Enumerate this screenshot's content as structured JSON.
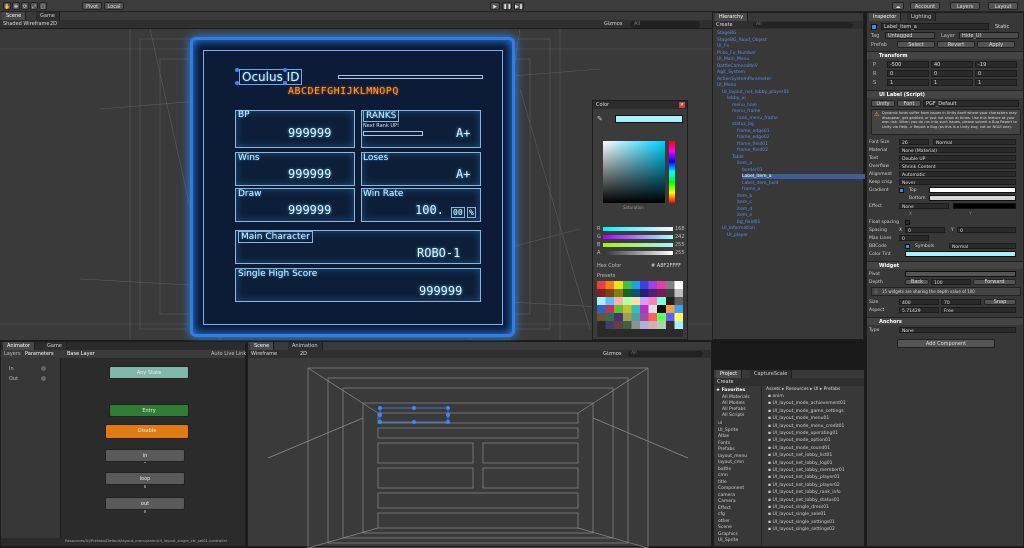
{
  "toolbar": {
    "pivot_label": "Pivot",
    "local_label": "Local",
    "account_label": "Account",
    "layers_label": "Layers",
    "layout_label": "Layout"
  },
  "scene": {
    "tab_scene": "Scene",
    "tab_game": "Game",
    "shading_mode": "Shaded Wireframe",
    "twod_label": "2D",
    "gizmos_label": "Gizmos",
    "search_placeholder": "All"
  },
  "game_ui": {
    "title": "Oculus ID",
    "id_text": "ABCDEFGHIJKLMNOPQ",
    "bp_label": "BP",
    "bp_value": "999999",
    "ranks_label": "RANKS",
    "next_rank_label": "Next Rank UP!",
    "rank_value": "A+",
    "wins_label": "Wins",
    "wins_value": "999999",
    "loses_label": "Loses",
    "loses_value": "A+",
    "draw_label": "Draw",
    "draw_value": "999999",
    "win_rate_label": "Win Rate",
    "win_rate_value": "100.",
    "win_rate_decimal": "00",
    "percent_label": "%",
    "main_char_label": "Main Character",
    "main_char_value": "ROBO-1",
    "high_score_label": "Single High Score",
    "high_score_value": "999999"
  },
  "color_picker": {
    "title": "Color",
    "saturation_label": "Saturation",
    "hex_label": "Hex Color",
    "hex_value": "# A8F2FFFF",
    "presets_label": "Presets",
    "channels": [
      {
        "label": "R",
        "value": "168"
      },
      {
        "label": "G",
        "value": "242"
      },
      {
        "label": "B",
        "value": "255"
      },
      {
        "label": "A",
        "value": "255"
      }
    ]
  },
  "hierarchy": {
    "tab": "Hierarchy",
    "create_label": "Create",
    "search_placeholder": "All",
    "items": [
      "StageBG",
      "StageBG_Road_Object",
      "UI_Fx",
      "Prize_Fx_Number",
      "UI_Main_Menu",
      "BattleCameraMoV",
      "Agit_System",
      "ActionSystemParameter",
      "UI_Menu",
      "UI_layout_net_lobby_player01",
      "lobby_ui",
      "menu_hole",
      "menu_frame",
      "rank_menu_frame",
      "status_bg",
      "frame_edge01",
      "frame_edge02",
      "frame_field01",
      "frame_field02",
      "Table",
      "item_a",
      "border01",
      "Label_item_a",
      "Label_item_hold",
      "frame_a",
      "item_b",
      "item_c",
      "item_d",
      "item_e",
      "bg_field01",
      "UI_Information",
      "UI_player"
    ]
  },
  "inspector": {
    "tab_inspector": "Inspector",
    "tab_lighting": "Lighting",
    "object_name": "Label_item_a",
    "static_label": "Static",
    "tag_label": "Tag",
    "tag_value": "Untagged",
    "layer_label": "Layer",
    "layer_value": "Hide_UI",
    "prefab_label": "Prefab",
    "prefab_select": "Select",
    "prefab_revert": "Revert",
    "prefab_apply": "Apply",
    "transform_label": "Transform",
    "position_label": "P",
    "position_values": [
      "-500",
      "40",
      "-19"
    ],
    "rotation_label": "R",
    "rotation_values": [
      "0",
      "0",
      "0"
    ],
    "scale_label": "S",
    "scale_values": [
      "1",
      "1",
      "1"
    ],
    "component_label": "UI Label (Script)",
    "component_tabs": [
      "Unity",
      "Font",
      "PGF_Default"
    ],
    "warning_text": "Dynamic fonts suffer from issues in Unity itself where your characters may disappear, get garbled, or just not show at times. Use this feature at your own risk.",
    "warning_text2": "When you do run into such issues, please submit a Bug Report to Unity via Help -> Report a Bug (as this is a Unity bug, not an NGUI one).",
    "font_size_label": "Font Size",
    "font_size_value": "26",
    "font_style_value": "Normal",
    "material_label": "Material",
    "material_value": "None (Material)",
    "text_label": "Text",
    "text_value": "Double UP",
    "overflow_label": "Overflow",
    "overflow_value": "Shrink Content",
    "alignment_label": "Alignment",
    "alignment_value": "Automatic",
    "keep_crisp_label": "Keep crisp",
    "keep_crisp_value": "Never",
    "gradient_label": "Gradient",
    "gradient_top": "Top",
    "gradient_bottom": "Bottom",
    "effect_label": "Effect",
    "effect_value": "None",
    "effect_x": "X",
    "effect_y": "Y",
    "float_spacing_label": "Float spacing",
    "spacing_label": "Spacing",
    "spacing_x": "0",
    "spacing_y": "0",
    "max_lines_label": "Max Lines",
    "max_lines_value": "0",
    "bbcode_label": "BBCode",
    "symbols_label": "Symbols",
    "symbols_value": "Normal",
    "color_tint_label": "Color Tint",
    "widget_label": "Widget",
    "pivot_label": "Pivot",
    "depth_label": "Depth",
    "back_label": "Back",
    "depth_value": "100",
    "forward_label": "Forward",
    "depth_note": "15 widgets are sharing the depth value of 100",
    "size_label": "Size",
    "size_w": "400",
    "size_h": "70",
    "snap_label": "Snap",
    "aspect_label": "Aspect",
    "aspect_value": "5.71429",
    "aspect_mode": "Free",
    "anchors_label": "Anchors",
    "anchor_type_label": "Type",
    "anchor_type_value": "None",
    "add_component_label": "Add Component"
  },
  "animator": {
    "tab_animator": "Animator",
    "tab_game": "Game",
    "layers_label": "Layers",
    "parameters_label": "Parameters",
    "base_layer": "Base Layer",
    "auto_live_link": "Auto Live Link",
    "params": [
      {
        "name": "In"
      },
      {
        "name": "Out"
      }
    ],
    "path": "Resources/UI/Prefabs/Default/layout_menu/anim/UI_layout_single_ctr_sel01.controller",
    "states": {
      "any": "Any State",
      "entry": "Entry",
      "disable": "Disable",
      "in": "in",
      "loop": "loop",
      "out": "out"
    }
  },
  "scene2": {
    "tab_scene": "Scene",
    "tab_animation": "Animation",
    "shading_mode": "Wireframe",
    "twod_label": "2D",
    "gizmos_label": "Gizmos",
    "search_placeholder": "All"
  },
  "project": {
    "tab_project": "Project",
    "tab_capture": "CaptureScale",
    "create_label": "Create",
    "breadcrumb": "Assets ▸ Resources ▸ UI ▸ Prefabs",
    "favorites_label": "Favorites",
    "favorites": [
      "All Materials",
      "All Models",
      "All Prefabs",
      "All Scripts"
    ],
    "folders": [
      "ui",
      "UI_Sprite",
      "Atlas",
      "Fonts",
      "Prefabs",
      "layout_menu",
      "layout_cmn",
      "battle",
      "cmn",
      "title",
      "Component",
      "camera",
      "Camera",
      "Effect",
      "cfg",
      "other",
      "Scene",
      "Graphics",
      "UI_Sprite"
    ],
    "files": [
      "anim",
      "UI_layout_mode_achievement01",
      "UI_layout_mode_game_settings",
      "UI_layout_mode_menu01",
      "UI_layout_mode_menu_credit01",
      "UI_layout_mode_operating01",
      "UI_layout_mode_option01",
      "UI_layout_mode_sound01",
      "UI_layout_net_lobby_list01",
      "UI_layout_net_lobby_log01",
      "UI_layout_net_lobby_member01",
      "UI_layout_net_lobby_player01",
      "UI_layout_net_lobby_player02",
      "UI_layout_net_lobby_rank_info",
      "UI_layout_net_lobby_status01",
      "UI_layout_single_dress01",
      "UI_layout_single_sele01",
      "UI_layout_single_settings01",
      "UI_layout_single_settings02"
    ]
  },
  "colors": {
    "accent_blue": "#3d87ff",
    "hier_blue": "#5b8de8",
    "orange_state": "#e07a12",
    "green_state": "#2e7d32",
    "teal_state": "#7fb8a8",
    "color_tint": "#a8f2ff"
  }
}
